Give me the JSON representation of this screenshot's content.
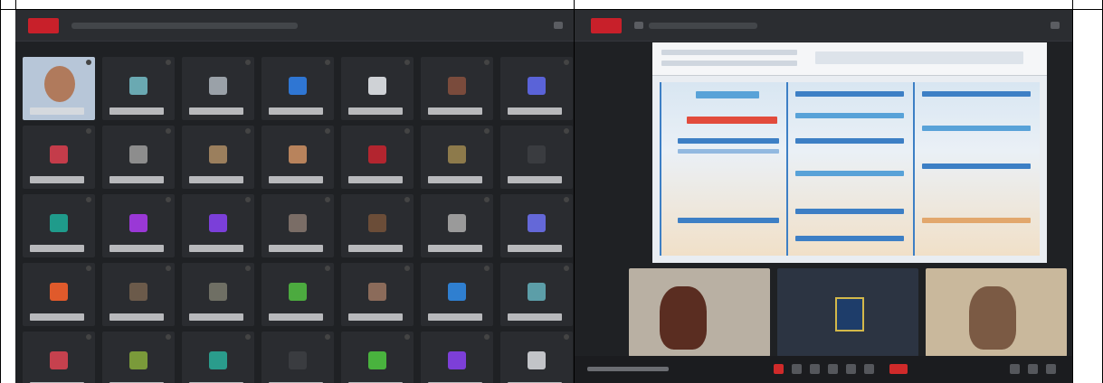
{
  "colors": {
    "panel_bg": "#1f2124",
    "topbar_bg": "#2b2d31",
    "record_red": "#c8202a",
    "accent_blue": "#3d7fc5"
  },
  "left_panel": {
    "topbar_icons": [
      "record-badge",
      "title-placeholder"
    ],
    "tiles": [
      {
        "kind": "video"
      },
      {
        "kind": "avatar",
        "color": "#6aa9b2"
      },
      {
        "kind": "avatar",
        "color": "#9aa1a8"
      },
      {
        "kind": "avatar",
        "color": "#2f76d3"
      },
      {
        "kind": "avatar",
        "color": "#cfd2d6"
      },
      {
        "kind": "avatar",
        "color": "#7a4b3c"
      },
      {
        "kind": "avatar",
        "color": "#5a63d8"
      },
      {
        "kind": "avatar",
        "color": "#c43c4a"
      },
      {
        "kind": "avatar",
        "color": "#8d8d8d"
      },
      {
        "kind": "avatar",
        "color": "#9b7f5d"
      },
      {
        "kind": "avatar",
        "color": "#b8835c"
      },
      {
        "kind": "avatar",
        "color": "#b3252f"
      },
      {
        "kind": "avatar",
        "color": "#8d7a4b"
      },
      {
        "kind": "avatar",
        "color": "#3a3c40"
      },
      {
        "kind": "avatar",
        "color": "#1f9b8b"
      },
      {
        "kind": "avatar",
        "color": "#9a38d6"
      },
      {
        "kind": "avatar",
        "color": "#7b3fd9"
      },
      {
        "kind": "avatar",
        "color": "#7a6d66"
      },
      {
        "kind": "avatar",
        "color": "#6b4d38"
      },
      {
        "kind": "avatar",
        "color": "#9a9a9a"
      },
      {
        "kind": "avatar",
        "color": "#6468d8"
      },
      {
        "kind": "avatar",
        "color": "#e05a2b"
      },
      {
        "kind": "avatar",
        "color": "#6b5a4a"
      },
      {
        "kind": "avatar",
        "color": "#6f6f64"
      },
      {
        "kind": "avatar",
        "color": "#4caa3f"
      },
      {
        "kind": "avatar",
        "color": "#8b6b5a"
      },
      {
        "kind": "avatar",
        "color": "#2f7fd0"
      },
      {
        "kind": "avatar",
        "color": "#5c9ea8"
      },
      {
        "kind": "avatar",
        "color": "#c6414e"
      },
      {
        "kind": "avatar",
        "color": "#7a9a3a"
      },
      {
        "kind": "avatar",
        "color": "#2a9c8c"
      },
      {
        "kind": "avatar",
        "color": "#3a3c40"
      },
      {
        "kind": "avatar",
        "color": "#49b33e"
      },
      {
        "kind": "avatar",
        "color": "#7d3fd8"
      },
      {
        "kind": "avatar",
        "color": "#c2c4c8"
      }
    ]
  },
  "right_panel": {
    "thumbs": [
      {
        "kind": "video",
        "color": "#b9b0a3"
      },
      {
        "kind": "avatar",
        "color": "#2c3442"
      },
      {
        "kind": "video",
        "color": "#c9b89c"
      }
    ]
  }
}
